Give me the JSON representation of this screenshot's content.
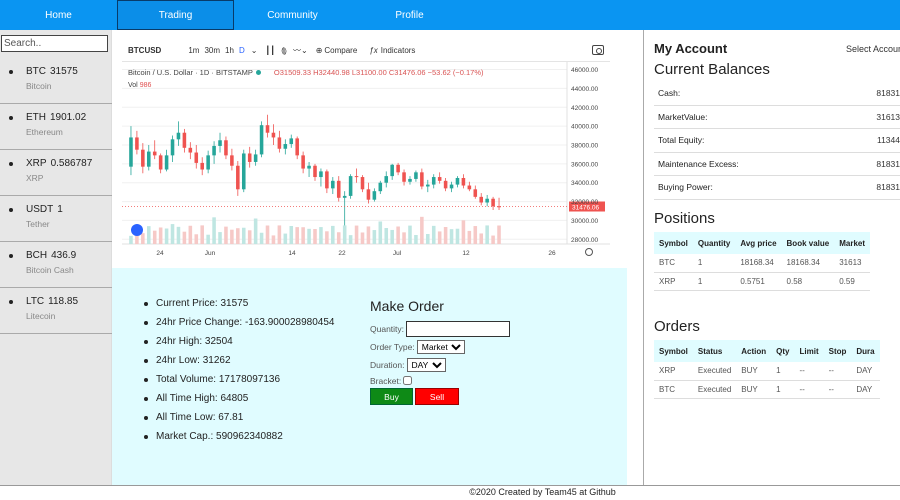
{
  "nav": {
    "tabs": [
      "Home",
      "Trading",
      "Community",
      "Profile"
    ],
    "active": "Trading"
  },
  "sidebar": {
    "search_placeholder": "Search..",
    "coins": [
      {
        "symbol": "BTC",
        "price": "31575",
        "name": "Bitcoin"
      },
      {
        "symbol": "ETH",
        "price": "1901.02",
        "name": "Ethereum"
      },
      {
        "symbol": "XRP",
        "price": "0.586787",
        "name": "XRP"
      },
      {
        "symbol": "USDT",
        "price": "1",
        "name": "Tether"
      },
      {
        "symbol": "BCH",
        "price": "436.9",
        "name": "Bitcoin Cash"
      },
      {
        "symbol": "LTC",
        "price": "118.85",
        "name": "Litecoin"
      }
    ]
  },
  "chart_toolbar": {
    "symbol": "BTCUSD",
    "intervals": [
      "1m",
      "30m",
      "1h",
      "D"
    ],
    "selected_interval": "D",
    "compare_label": "Compare",
    "indicators_label": "Indicators"
  },
  "chart_header": {
    "title": "Bitcoin / U.S. Dollar · 1D · BITSTAMP",
    "ohlc": "O31509.33 H32440.98 L31100.00 C31476.06 −53.62 (−0.17%)",
    "vol_label": "Vol",
    "vol_value": "986"
  },
  "chart_data": {
    "type": "candlestick",
    "title": "Bitcoin / U.S. Dollar · 1D · BITSTAMP",
    "y_ticks": [
      46000,
      44000,
      42000,
      40000,
      38000,
      36000,
      34000,
      32000,
      30000,
      28000
    ],
    "x_ticks": [
      "24",
      "Jun",
      "14",
      "22",
      "Jul",
      "12",
      "26"
    ],
    "ylim": [
      27500,
      46800
    ],
    "last_price": "31476.06",
    "ohlc": [
      [
        35700,
        40000,
        34800,
        38800
      ],
      [
        38800,
        39500,
        37000,
        37500
      ],
      [
        37500,
        38200,
        35000,
        35700
      ],
      [
        35700,
        38000,
        35300,
        37300
      ],
      [
        37300,
        38500,
        36500,
        36900
      ],
      [
        36900,
        37100,
        35000,
        35400
      ],
      [
        35400,
        37500,
        35200,
        36900
      ],
      [
        36900,
        39000,
        36200,
        38600
      ],
      [
        38600,
        40500,
        37900,
        39300
      ],
      [
        39300,
        39700,
        37200,
        37700
      ],
      [
        37700,
        38300,
        36500,
        37200
      ],
      [
        37200,
        38000,
        35500,
        36100
      ],
      [
        36100,
        36700,
        34800,
        35400
      ],
      [
        35400,
        37400,
        35000,
        36900
      ],
      [
        36900,
        38400,
        36000,
        37900
      ],
      [
        37900,
        39300,
        37200,
        38500
      ],
      [
        38500,
        38900,
        36500,
        36900
      ],
      [
        36900,
        37600,
        35300,
        35800
      ],
      [
        35800,
        36300,
        32600,
        33300
      ],
      [
        33300,
        37500,
        33000,
        37100
      ],
      [
        37100,
        37800,
        35600,
        36200
      ],
      [
        36200,
        37500,
        35800,
        37000
      ],
      [
        37000,
        40500,
        36700,
        40100
      ],
      [
        40100,
        41200,
        38800,
        39300
      ],
      [
        39300,
        40200,
        38000,
        38800
      ],
      [
        38800,
        39500,
        37200,
        37600
      ],
      [
        37600,
        38600,
        37000,
        38100
      ],
      [
        38100,
        39100,
        37700,
        38700
      ],
      [
        38700,
        38900,
        36500,
        36900
      ],
      [
        36900,
        37300,
        35000,
        35500
      ],
      [
        35500,
        36200,
        34600,
        35800
      ],
      [
        35800,
        36000,
        34200,
        34600
      ],
      [
        34600,
        35500,
        33600,
        35200
      ],
      [
        35200,
        35400,
        32900,
        33400
      ],
      [
        33400,
        34600,
        32800,
        34200
      ],
      [
        34200,
        34700,
        32000,
        32400
      ],
      [
        32400,
        33100,
        29300,
        32600
      ],
      [
        32600,
        34900,
        32300,
        34700
      ],
      [
        34700,
        35500,
        34000,
        34600
      ],
      [
        34600,
        34800,
        33000,
        33300
      ],
      [
        33300,
        34000,
        31800,
        32200
      ],
      [
        32200,
        33400,
        32000,
        33100
      ],
      [
        33100,
        34200,
        32800,
        34000
      ],
      [
        34000,
        35200,
        33500,
        34700
      ],
      [
        34700,
        36000,
        34300,
        35900
      ],
      [
        35900,
        36100,
        34800,
        35100
      ],
      [
        35100,
        35400,
        33700,
        34100
      ],
      [
        34100,
        34700,
        33800,
        34400
      ],
      [
        34400,
        35300,
        34100,
        35100
      ],
      [
        35100,
        35500,
        33300,
        33600
      ],
      [
        33600,
        34300,
        33000,
        33800
      ],
      [
        33800,
        34900,
        33400,
        34600
      ],
      [
        34600,
        35100,
        33900,
        34200
      ],
      [
        34200,
        34500,
        33100,
        33400
      ],
      [
        33400,
        34100,
        33000,
        33800
      ],
      [
        33800,
        34700,
        33500,
        34500
      ],
      [
        34500,
        34900,
        33400,
        33700
      ],
      [
        33700,
        34100,
        33100,
        33300
      ],
      [
        33300,
        33700,
        32300,
        32500
      ],
      [
        32500,
        32900,
        31600,
        31900
      ],
      [
        31900,
        32700,
        31500,
        32300
      ],
      [
        32300,
        32500,
        31100,
        31500
      ],
      [
        31500,
        32400,
        31100,
        31476
      ]
    ]
  },
  "stats": [
    {
      "label": "Current Price",
      "value": "31575"
    },
    {
      "label": "24hr Price Change",
      "value": "-163.900028980454"
    },
    {
      "label": "24hr High",
      "value": "32504"
    },
    {
      "label": "24hr Low",
      "value": "31262"
    },
    {
      "label": "Total Volume",
      "value": "17178097136"
    },
    {
      "label": "All Time High",
      "value": "64805"
    },
    {
      "label": "All Time Low",
      "value": "67.81"
    },
    {
      "label": "Market Cap.",
      "value": "590962340882"
    }
  ],
  "order_form": {
    "title": "Make Order",
    "quantity_label": "Quantity:",
    "order_type_label": "Order Type:",
    "order_type_value": "Market",
    "duration_label": "Duration:",
    "duration_value": "DAY",
    "bracket_label": "Bracket:",
    "buy_label": "Buy",
    "sell_label": "Sell"
  },
  "account": {
    "title": "My Account",
    "select_label": "Select Accoun",
    "balances_title": "Current Balances",
    "balances": [
      {
        "label": "Cash:",
        "value": "81831"
      },
      {
        "label": "MarketValue:",
        "value": "31613"
      },
      {
        "label": "Total Equity:",
        "value": "11344"
      },
      {
        "label": "Maintenance Excess:",
        "value": "81831"
      },
      {
        "label": "Buying Power:",
        "value": "81831"
      }
    ],
    "positions_title": "Positions",
    "positions_headers": [
      "Symbol",
      "Quantity",
      "Avg price",
      "Book value",
      "Market"
    ],
    "positions": [
      [
        "BTC",
        "1",
        "18168.34",
        "18168.34",
        "31613"
      ],
      [
        "XRP",
        "1",
        "0.5751",
        "0.58",
        "0.59"
      ]
    ],
    "orders_title": "Orders",
    "orders_headers": [
      "Symbol",
      "Status",
      "Action",
      "Qty",
      "Limit",
      "Stop",
      "Dura"
    ],
    "orders": [
      [
        "XRP",
        "Executed",
        "BUY",
        "1",
        "--",
        "--",
        "DAY"
      ],
      [
        "BTC",
        "Executed",
        "BUY",
        "1",
        "--",
        "--",
        "DAY"
      ]
    ]
  },
  "footer": "©2020 Created by Team45 at Github",
  "colors": {
    "nav": "#0a95f2",
    "panel": "#e0fcff",
    "up": "#26a69a",
    "down": "#ef5350",
    "buy": "#0e8a16",
    "sell": "#ff0000"
  }
}
